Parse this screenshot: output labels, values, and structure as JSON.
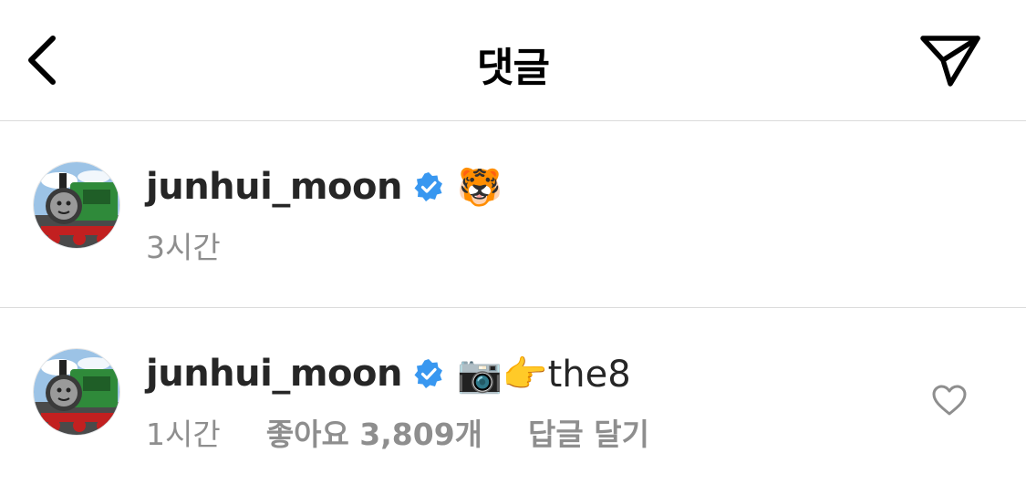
{
  "header": {
    "title": "댓글",
    "back_icon": "chevron-left-icon",
    "send_icon": "paper-plane-icon"
  },
  "comments": [
    {
      "username": "junhui_moon",
      "verified": true,
      "text": "🐯",
      "time": "3시간",
      "likes": "",
      "reply": ""
    },
    {
      "username": "junhui_moon",
      "verified": true,
      "text": "📷👉the8",
      "time": "1시간",
      "likes": "좋아요 3,809개",
      "reply": "답글 달기"
    }
  ],
  "colors": {
    "verified_blue": "#3897f0",
    "meta_gray": "#8e8e8e",
    "divider": "#dbdbdb"
  }
}
